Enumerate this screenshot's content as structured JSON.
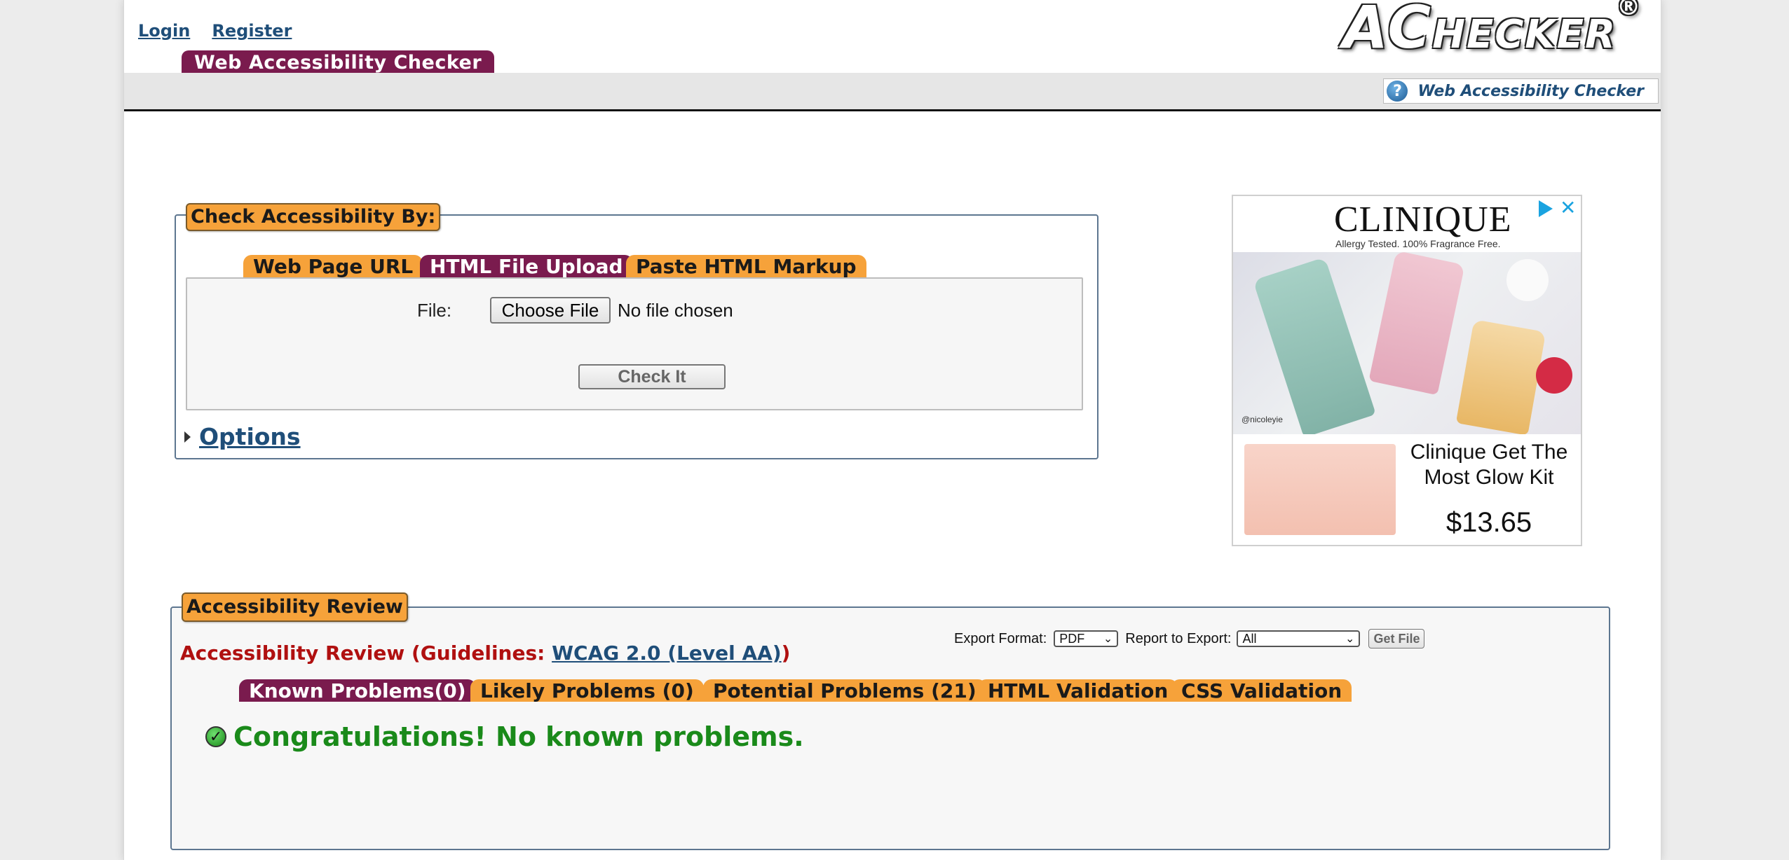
{
  "header": {
    "login": "Login",
    "register": "Register",
    "logo_first": "AC",
    "logo_rest": "HECKER",
    "logo_reg": "®",
    "site_tab": "Web Accessibility Checker",
    "right_link": "Web Accessibility Checker"
  },
  "check": {
    "legend": "Check Accessibility By:",
    "tabs": [
      "Web Page URL",
      "HTML File Upload",
      "Paste HTML Markup"
    ],
    "active_tab": "HTML File Upload",
    "file_label": "File:",
    "choose_button": "Choose File",
    "no_file": "No file chosen",
    "check_button": "Check It",
    "options": "Options"
  },
  "ad": {
    "brand": "CLINIQUE",
    "tagline": "Allergy Tested. 100% Fragrance Free.",
    "photo_credit": "@nicoleyie",
    "product": "Clinique Get The Most Glow Kit",
    "price": "$13.65"
  },
  "review": {
    "legend": "Accessibility Review",
    "heading_prefix": "Accessibility Review (Guidelines: ",
    "guideline_link": "WCAG 2.0 (Level AA)",
    "heading_suffix": ")",
    "export_format_label": "Export Format:",
    "export_format_value": "PDF",
    "report_label": "Report to Export:",
    "report_value": "All",
    "get_file": "Get File",
    "tabs": [
      "Known Problems(0)",
      "Likely Problems (0)",
      "Potential Problems (21)",
      "HTML Validation",
      "CSS Validation"
    ],
    "active_tab": "Known Problems(0)",
    "message": "Congratulations! No known problems."
  },
  "colors": {
    "accent_purple": "#7a1b4e",
    "accent_orange": "#f6a23a",
    "link_blue": "#1f4e79",
    "success_green": "#1a8a1a",
    "heading_red": "#b01010"
  }
}
